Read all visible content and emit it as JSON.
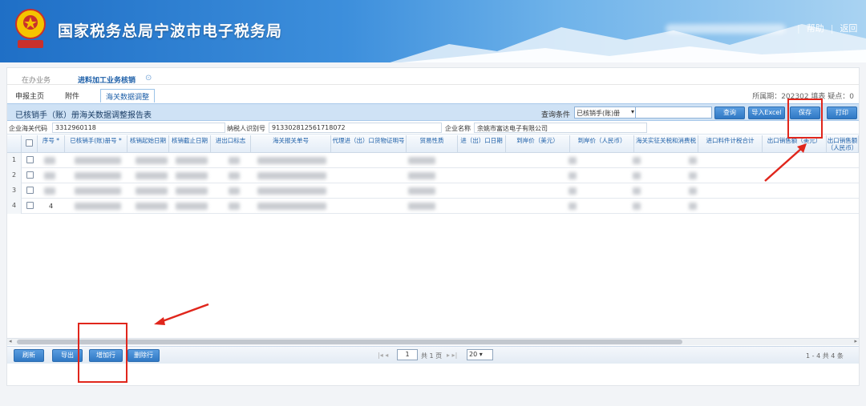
{
  "header": {
    "title": "国家税务总局宁波市电子税务局",
    "links": [
      "帮助",
      "返回"
    ]
  },
  "tabs": {
    "inbox": "在办业务",
    "current": "进料加工业务核销",
    "close_icon": "close-circle-icon"
  },
  "subtabs": [
    "申报主页",
    "附件",
    "海关数据调整"
  ],
  "period_info": "所属期：202302   填表   疑点：0",
  "report": {
    "title": "已核销手（账）册海关数据调整报告表",
    "query_label": "查询条件",
    "query_select": "已核销手(账)册",
    "buttons": {
      "query": "查询",
      "excel": "导入Excel",
      "save": "保存",
      "print": "打印"
    }
  },
  "info": {
    "customs_code_label": "企业海关代码",
    "customs_code": "3312960118",
    "taxpayer_id_label": "纳税人识别号",
    "taxpayer_id": "91330281256171807​2",
    "company_label": "企业名称",
    "company": "余姚市富达电子有限公司"
  },
  "grid": {
    "columns": [
      "序号 *",
      "已核销手(账)册号 *",
      "核销起始日期",
      "核销截止日期",
      "进出口标志",
      "海关报关单号",
      "代理进（出）口货物证明号",
      "贸易性质",
      "进（出）口日期",
      "到岸价（美元）",
      "到岸价（人民币）",
      "海关实征关税和消费税",
      "进口料件计税合计",
      "出口销售额（美元）",
      "出口销售额（人民币）"
    ],
    "rows": [
      {
        "num": "1",
        "seq": ""
      },
      {
        "num": "2",
        "seq": ""
      },
      {
        "num": "3",
        "seq": ""
      },
      {
        "num": "4",
        "seq": "4"
      }
    ]
  },
  "pager": {
    "refresh": "刷新",
    "export": "导出",
    "add_row": "增加行",
    "delete_row": "删除行",
    "page": "1",
    "total_pages": "共 1 页",
    "page_size": "20",
    "summary": "1 - 4  共 4 条"
  },
  "colors": {
    "banner": "#2f80d2",
    "button": "#3a83cc",
    "highlight": "#e0261c"
  }
}
